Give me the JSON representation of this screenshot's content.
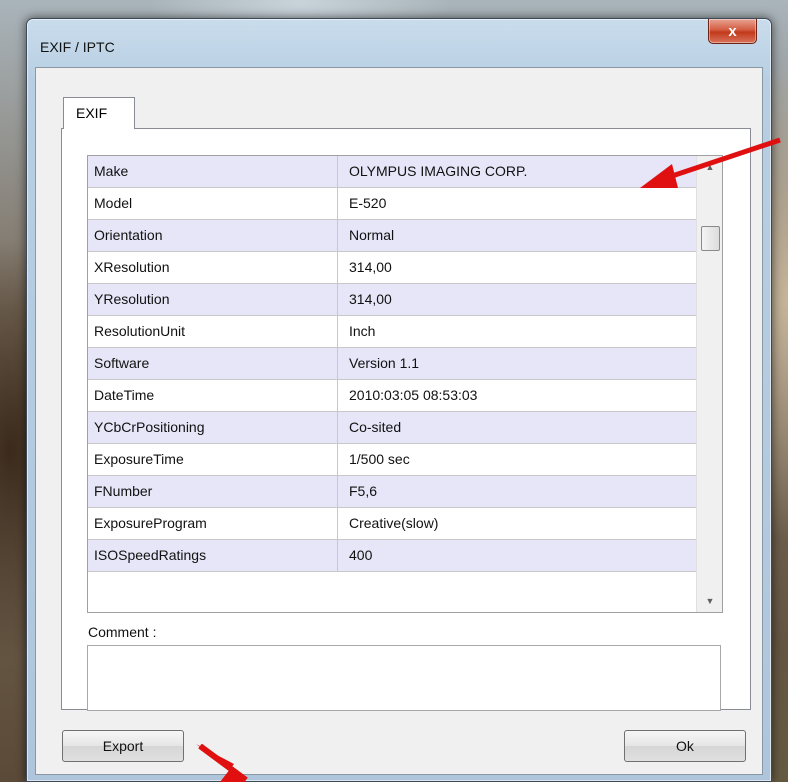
{
  "window": {
    "title": "EXIF / IPTC",
    "close_label": "x"
  },
  "tabs": [
    {
      "label": "EXIF",
      "active": true
    }
  ],
  "exif_rows": [
    {
      "name": "Make",
      "value": "OLYMPUS IMAGING CORP."
    },
    {
      "name": "Model",
      "value": "E-520"
    },
    {
      "name": "Orientation",
      "value": "Normal"
    },
    {
      "name": "XResolution",
      "value": "314,00"
    },
    {
      "name": "YResolution",
      "value": "314,00"
    },
    {
      "name": "ResolutionUnit",
      "value": "Inch"
    },
    {
      "name": "Software",
      "value": "Version 1.1"
    },
    {
      "name": "DateTime",
      "value": "2010:03:05 08:53:03"
    },
    {
      "name": "YCbCrPositioning",
      "value": "Co-sited"
    },
    {
      "name": "ExposureTime",
      "value": "1/500 sec"
    },
    {
      "name": "FNumber",
      "value": "F5,6"
    },
    {
      "name": "ExposureProgram",
      "value": "Creative(slow)"
    },
    {
      "name": "ISOSpeedRatings",
      "value": "400"
    }
  ],
  "comment": {
    "label": "Comment :",
    "value": ""
  },
  "buttons": {
    "export_label": "Export",
    "ok_label": "Ok"
  },
  "colors": {
    "alt_row": "#e6e6f8",
    "annotation_arrow": "#e01010",
    "close_button": "#c2391b"
  },
  "icons": {
    "scroll_up": "▲",
    "scroll_down": "▼"
  }
}
